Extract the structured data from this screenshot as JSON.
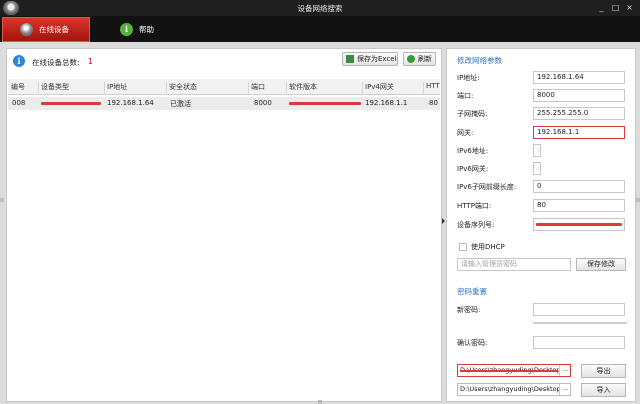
{
  "window": {
    "title": "设备网络搜索",
    "controls": [
      "_",
      "□",
      "×"
    ]
  },
  "tabs": [
    {
      "label": "在线设备"
    },
    {
      "label": "帮助",
      "icon": "i"
    }
  ],
  "device_list": {
    "count_label": "在线设备总数:",
    "count": "1",
    "export_button": "保存为Excel",
    "refresh_button": "刷新",
    "columns": [
      "编号",
      "设备类型",
      "IP地址",
      "安全状态",
      "端口",
      "软件版本",
      "IPv4网关",
      "HTT"
    ],
    "rows": [
      {
        "index": "008",
        "ip": "192.168.1.64",
        "status": "已激活",
        "port": "8000",
        "gateway": "192.168.1.1",
        "http": "80"
      }
    ]
  },
  "modify_network": {
    "title": "修改网络参数",
    "fields": [
      {
        "label": "IP地址:",
        "value": "192.168.1.64"
      },
      {
        "label": "端口:",
        "value": "8000"
      },
      {
        "label": "子网掩码:",
        "value": "255.255.255.0"
      },
      {
        "label": "网关:",
        "value": "192.168.1.1"
      },
      {
        "label": "IPv6地址:",
        "value": "::"
      },
      {
        "label": "IPv6网关:",
        "value": "::"
      },
      {
        "label": "IPv6子网前缀长度:",
        "value": "0"
      },
      {
        "label": "HTTP端口:",
        "value": "80"
      },
      {
        "label": "设备序列号:",
        "value": ""
      }
    ],
    "dhcp_label": "使用DHCP",
    "admin_password_placeholder": "请输入管理员密码",
    "save_button": "保存修改"
  },
  "password_reset": {
    "title": "密码重置",
    "new_password_label": "新密码:",
    "confirm_password_label": "确认密码:",
    "export_path": "D:\\Users\\zhangyuding\\Desktop",
    "import_path": "D:\\Users\\zhangyuding\\Desktop",
    "browse_label": "...",
    "export_button": "导出",
    "import_button": "导入"
  },
  "colors": {
    "accent": "#2f76c2",
    "redaction": "#d93a3a",
    "active_tab": "#c0221a"
  }
}
